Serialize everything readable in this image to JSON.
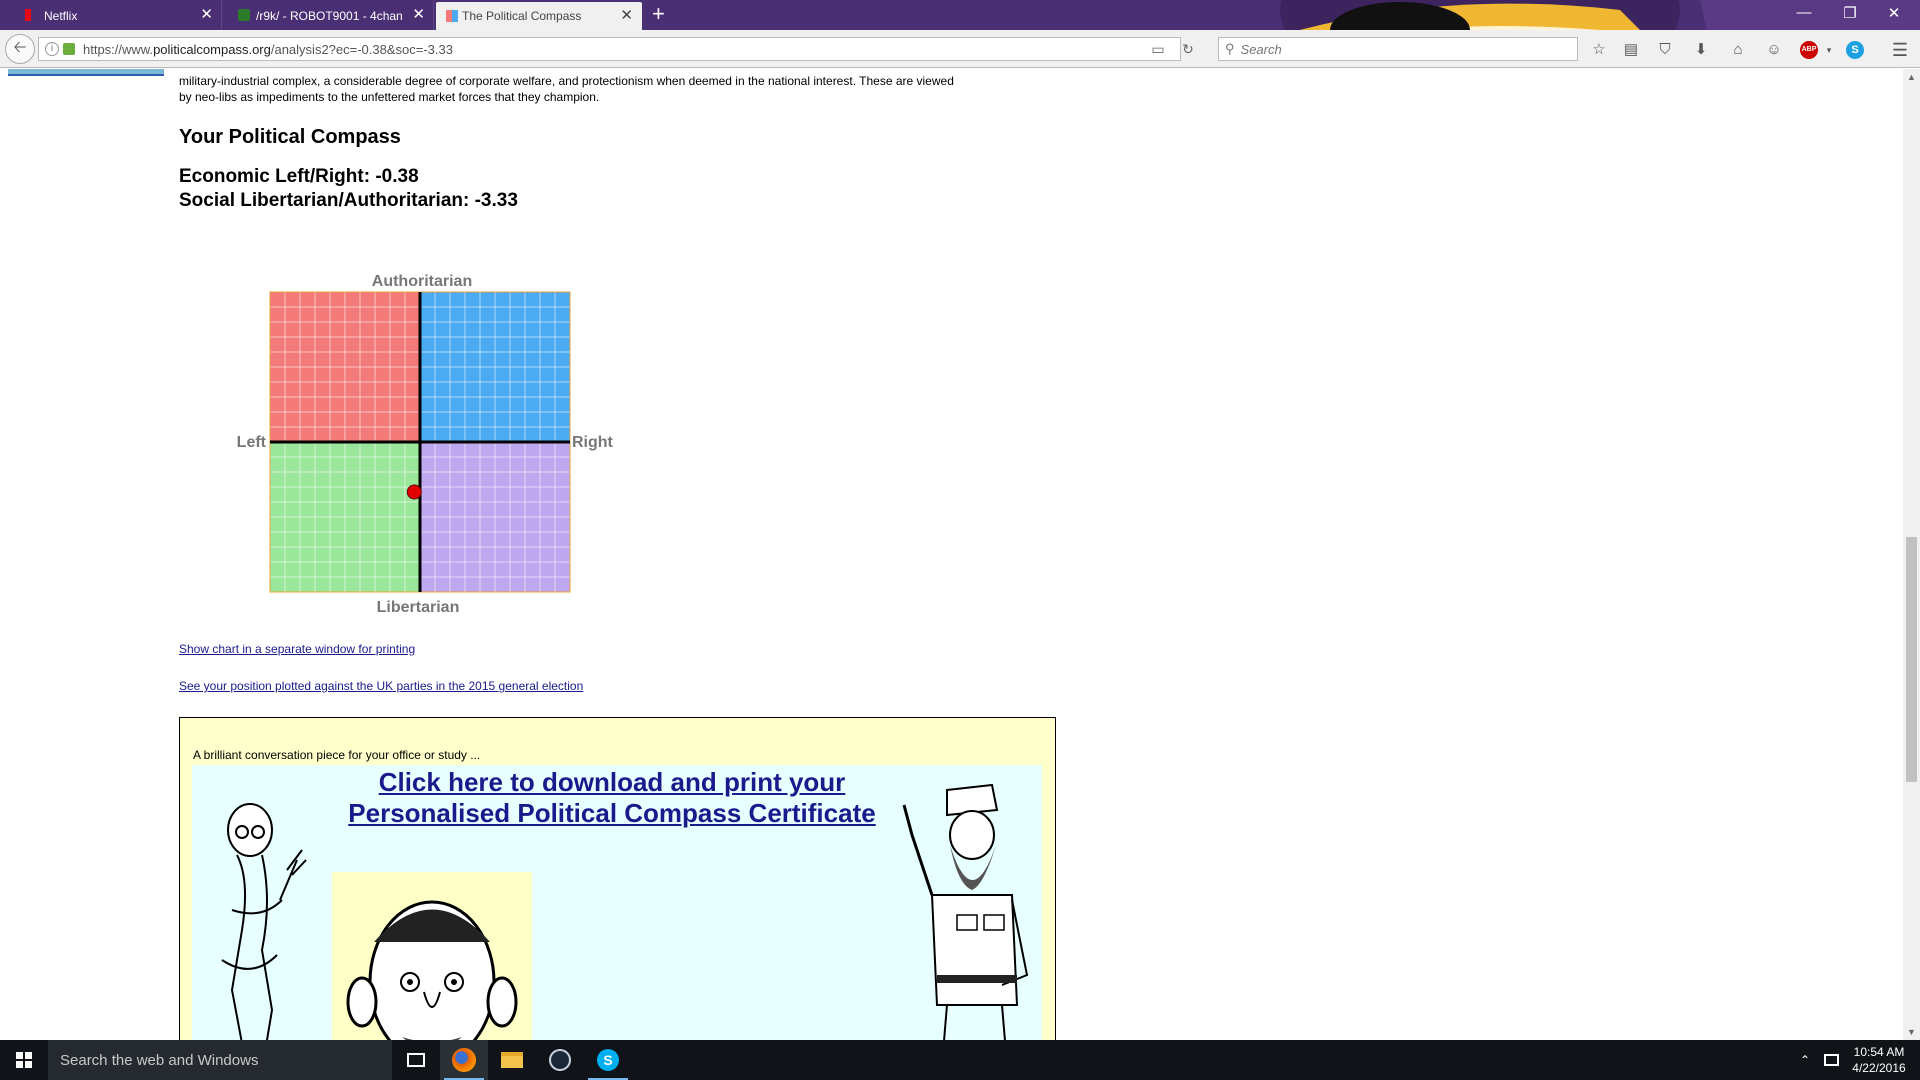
{
  "browser": {
    "tabs": [
      {
        "title": "Netflix",
        "favicon": "netflix-icon",
        "active": false
      },
      {
        "title": "/r9k/ - ROBOT9001 - 4chan",
        "favicon": "4chan-icon",
        "active": false
      },
      {
        "title": "The Political Compass",
        "favicon": "compass-icon",
        "active": true
      }
    ],
    "url_prefix": "https://www.",
    "url_domain": "politicalcompass.org",
    "url_path": "/analysis2?ec=-0.38&soc=-3.33",
    "search_placeholder": "Search"
  },
  "page": {
    "intro_line1": "military-industrial complex, a considerable degree of corporate welfare, and protectionism when deemed in the national interest. These are viewed",
    "intro_line2": "by neo-libs as impediments to the unfettered market forces that they champion.",
    "compass_heading": "Your Political Compass",
    "economic_label": "Economic Left/Right: -0.38",
    "social_label": "Social Libertarian/Authoritarian: -3.33",
    "link_print": "Show chart in a separate window for printing",
    "link_uk": "See your position plotted against the UK parties in the 2015 general election",
    "cert_caption": "A brilliant conversation piece for your office or study ...",
    "cert_title_line1": "Click here to download and print your",
    "cert_title_line2": "Personalised Political Compass Certificate"
  },
  "chart_data": {
    "type": "scatter",
    "title": "",
    "top_label": "Authoritarian",
    "bottom_label": "Libertarian",
    "left_label": "Left",
    "right_label": "Right",
    "xlim": [
      -10,
      10
    ],
    "ylim": [
      -10,
      10
    ],
    "grid": true,
    "quadrant_colors": {
      "top_left": "#f47a7a",
      "top_right": "#4aaaf2",
      "bottom_left": "#9ae69a",
      "bottom_right": "#c0a8f0"
    },
    "points": [
      {
        "x": -0.38,
        "y": -3.33,
        "color": "#e00000"
      }
    ]
  },
  "taskbar": {
    "search_placeholder": "Search the web and Windows",
    "time": "10:54 AM",
    "date": "4/22/2016"
  }
}
